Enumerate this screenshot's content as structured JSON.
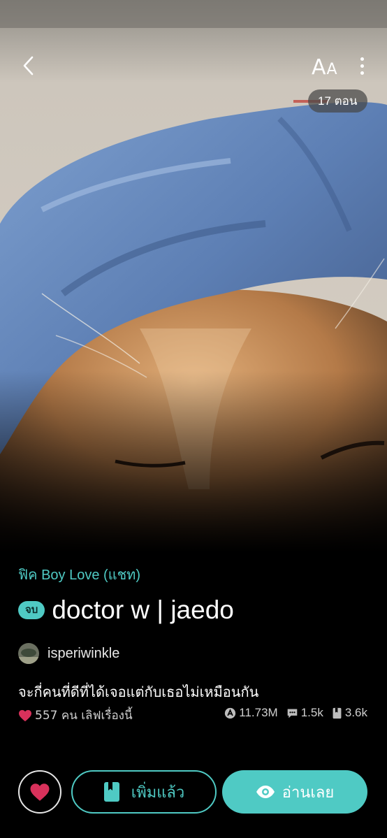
{
  "header": {
    "back_icon": "chevron-left-icon",
    "font_size_label_big": "A",
    "font_size_label_small": "A",
    "more_icon": "more-vertical-icon",
    "episode_count": "17 ตอน"
  },
  "cover": {
    "description_icon": "cover-image"
  },
  "story": {
    "category": "ฟิค Boy Love (แชท)",
    "status": "จบ",
    "title": "doctor w | jaedo",
    "author": "isperiwinkle",
    "tagline": "จะกี่คนที่ดีที่ได้เจอแต่กับเธอไม่เหมือนกัน",
    "likes_text": "557 คน เลิฟเรื่องนี้",
    "views": "11.73M",
    "comments": "1.5k",
    "bookmarks": "3.6k"
  },
  "actions": {
    "add_to_library_label": "เพิ่มแล้ว",
    "read_now_label": "อ่านเลย"
  },
  "colors": {
    "accent": "#4fcac4",
    "heart": "#d8315b",
    "background": "#000000"
  }
}
